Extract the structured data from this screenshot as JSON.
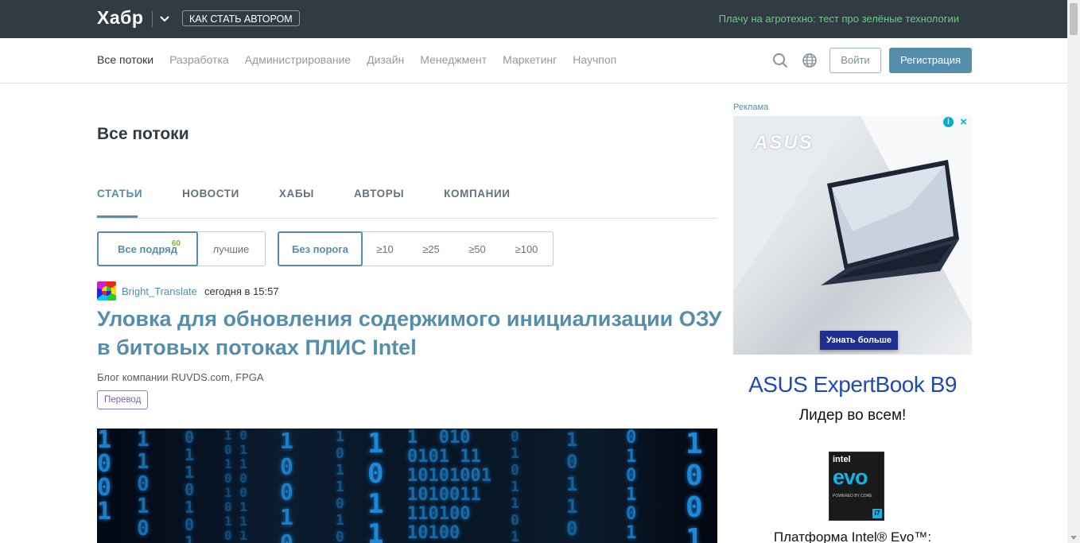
{
  "header": {
    "logo": "Хабр",
    "author_button": "КАК СТАТЬ АВТОРОМ",
    "promo": "Плачу на агротехно: тест про зелёные технологии",
    "colors": {
      "bg": "#303b44",
      "promo": "#65d07e"
    }
  },
  "nav": {
    "items": [
      {
        "label": "Все потоки",
        "active": true
      },
      {
        "label": "Разработка"
      },
      {
        "label": "Администрирование"
      },
      {
        "label": "Дизайн"
      },
      {
        "label": "Менеджмент"
      },
      {
        "label": "Маркетинг"
      },
      {
        "label": "Научпоп"
      }
    ],
    "icons": [
      "search-icon",
      "globe-icon"
    ],
    "login": "Войти",
    "register": "Регистрация"
  },
  "main": {
    "title": "Все потоки",
    "tabs": [
      {
        "label": "СТАТЬИ",
        "active": true
      },
      {
        "label": "НОВОСТИ"
      },
      {
        "label": "ХАБЫ"
      },
      {
        "label": "АВТОРЫ"
      },
      {
        "label": "КОМПАНИИ"
      }
    ],
    "filters": {
      "sort": [
        {
          "label": "Все подряд",
          "count": "60",
          "selected": true
        },
        {
          "label": "лучшие"
        }
      ],
      "rating": [
        {
          "label": "Без порога",
          "selected": true
        },
        {
          "label": "≥10"
        },
        {
          "label": "≥25"
        },
        {
          "label": "≥50"
        },
        {
          "label": "≥100"
        }
      ]
    },
    "article": {
      "author": "Bright_Translate",
      "time": "сегодня в 15:57",
      "title": "Уловка для обновления содержимого инициализации ОЗУ в битовых потоках ПЛИС Intel",
      "hubs": "Блог компании RUVDS.com,  FPGA",
      "badge": "Перевод"
    }
  },
  "ad": {
    "label": "Реклама",
    "brand": "ASUS",
    "cta": "Узнать больше",
    "product": "ASUS ExpertBook B9",
    "slogan": "Лидер во всем!",
    "chip_brand": "intel",
    "chip_name": "evo",
    "chip_small": "POWERED BY CORE",
    "chip_gen": "i7",
    "platform": "Платформа Intel® Evo™:"
  },
  "colors": {
    "accent": "#548eaa",
    "accent_dark": "#303b44",
    "badge": "#7a5db0"
  }
}
